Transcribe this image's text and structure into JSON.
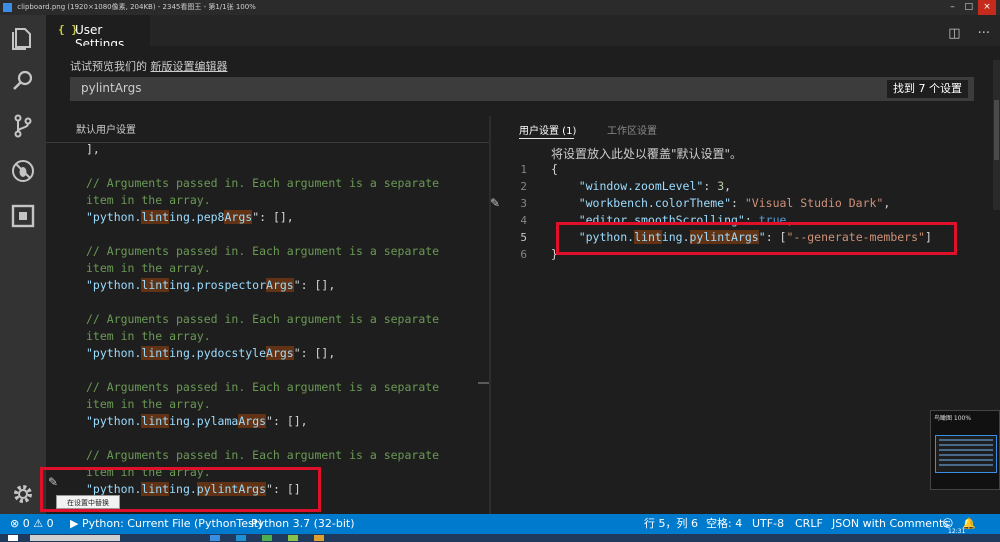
{
  "viewer": {
    "title": "clipboard.png (1920×1080像素, 204KB) - 2345看图王 - 第1/1张 100%"
  },
  "activity_bar": {
    "icons": [
      "files-icon",
      "search-icon",
      "source-control-icon",
      "debug-icon",
      "extensions-icon",
      "gear-icon"
    ]
  },
  "tab": {
    "label": "User Settings",
    "braces": "{ }"
  },
  "settings": {
    "preview_prefix": "试试预览我们的",
    "preview_link": "新版设置编辑器",
    "search_value": "pylintArgs",
    "result_count": "找到 7 个设置"
  },
  "left_pane": {
    "title": "默认用户设置",
    "lines": [
      {
        "text": "],",
        "cls": "punc"
      },
      {
        "text": "",
        "cls": "punc"
      },
      {
        "text": "// Arguments passed in. Each argument is a separate",
        "cls": "comment"
      },
      {
        "text": "item in the array.",
        "cls": "comment"
      },
      {
        "pre": "\"python.",
        "hl1": "lint",
        "mid": "ing.pep8",
        "hl2": "Args",
        "post": "\": [],",
        "type": "setting"
      },
      {
        "text": "",
        "cls": "punc"
      },
      {
        "text": "// Arguments passed in. Each argument is a separate",
        "cls": "comment"
      },
      {
        "text": "item in the array.",
        "cls": "comment"
      },
      {
        "pre": "\"python.",
        "hl1": "lint",
        "mid": "ing.prospector",
        "hl2": "Args",
        "post": "\": [],",
        "type": "setting"
      },
      {
        "text": "",
        "cls": "punc"
      },
      {
        "text": "// Arguments passed in. Each argument is a separate",
        "cls": "comment"
      },
      {
        "text": "item in the array.",
        "cls": "comment"
      },
      {
        "pre": "\"python.",
        "hl1": "lint",
        "mid": "ing.pydocstyle",
        "hl2": "Args",
        "post": "\": [],",
        "type": "setting"
      },
      {
        "text": "",
        "cls": "punc"
      },
      {
        "text": "// Arguments passed in. Each argument is a separate",
        "cls": "comment"
      },
      {
        "text": "item in the array.",
        "cls": "comment"
      },
      {
        "pre": "\"python.",
        "hl1": "lint",
        "mid": "ing.pylama",
        "hl2": "Args",
        "post": "\": [],",
        "type": "setting"
      },
      {
        "text": "",
        "cls": "punc"
      },
      {
        "text": "// Arguments passed in. Each argument is a separate",
        "cls": "comment"
      },
      {
        "text": "item in the array.",
        "cls": "comment"
      },
      {
        "pre": "\"python.",
        "hl1": "lint",
        "mid": "ing.",
        "hl2": "pylintArgs",
        "post": "\": []",
        "type": "setting"
      }
    ],
    "tooltip": "在设置中替换"
  },
  "right_pane": {
    "tab_user": "用户设置 (1)",
    "tab_workspace": "工作区设置",
    "hint": "将设置放入此处以覆盖\"默认设置\"。",
    "line_numbers": [
      "1",
      "2",
      "3",
      "4",
      "5",
      "6"
    ],
    "lines": [
      {
        "parts": [
          {
            "t": "{",
            "c": "punc"
          }
        ]
      },
      {
        "parts": [
          {
            "t": "    \"window.zoomLevel\"",
            "c": "key"
          },
          {
            "t": ": ",
            "c": "punc"
          },
          {
            "t": "3",
            "c": "num"
          },
          {
            "t": ",",
            "c": "punc"
          }
        ]
      },
      {
        "parts": [
          {
            "t": "    \"workbench.colorTheme\"",
            "c": "key"
          },
          {
            "t": ": ",
            "c": "punc"
          },
          {
            "t": "\"Visual Studio Dark\"",
            "c": "str"
          },
          {
            "t": ",",
            "c": "punc"
          }
        ]
      },
      {
        "parts": [
          {
            "t": "    \"editor.smoothScrolling\"",
            "c": "key"
          },
          {
            "t": ": ",
            "c": "punc"
          },
          {
            "t": "true",
            "c": "kw"
          },
          {
            "t": ",",
            "c": "punc"
          }
        ]
      },
      {
        "parts": [
          {
            "t": "    \"python.",
            "c": "key"
          },
          {
            "t": "lint",
            "c": "key hl"
          },
          {
            "t": "ing.",
            "c": "key"
          },
          {
            "t": "pylintArgs",
            "c": "key hl"
          },
          {
            "t": "\"",
            "c": "key"
          },
          {
            "t": ": [",
            "c": "punc"
          },
          {
            "t": "\"--generate-members\"",
            "c": "str"
          },
          {
            "t": "]",
            "c": "punc"
          }
        ]
      },
      {
        "parts": [
          {
            "t": "}",
            "c": "punc"
          }
        ]
      }
    ],
    "active_line": "5"
  },
  "minimap": {
    "caption": "鸟瞰图 100%"
  },
  "statusbar": {
    "errors": "0",
    "warnings": "0",
    "run_target": "Python: Current File (PythonTest)",
    "interpreter": "Python 3.7 (32-bit)",
    "position": "行 5，列 6",
    "spaces": "空格: 4",
    "encoding": "UTF-8",
    "eol": "CRLF",
    "language": "JSON with Comments",
    "clock": "12:31"
  },
  "colors": {
    "statusbar": "#007acc",
    "annotation_red": "#e0102a",
    "match_highlight": "#613214"
  }
}
